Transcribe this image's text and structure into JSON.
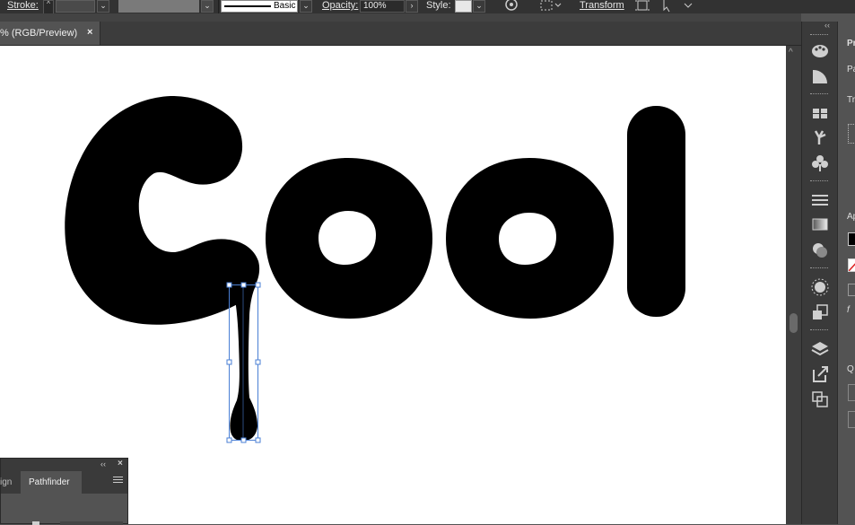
{
  "control_bar": {
    "stroke_label": "Stroke:",
    "stroke_profile": "Basic",
    "opacity_label": "Opacity:",
    "opacity_value": "100%",
    "style_label": "Style:",
    "transform_label": "Transform",
    "spinner_up": "^",
    "spinner_down": "v",
    "chevron": "⌄",
    "arrow_right": "›"
  },
  "document_tab": {
    "title": "% (RGB/Preview)",
    "close": "×"
  },
  "artwork": {
    "text": "Cool",
    "fill": "#000000",
    "selection_color": "#4a7fd4"
  },
  "dock": {
    "collapse": "‹‹",
    "icons": [
      "color-palette-icon",
      "color-guide-icon",
      "swatches-icon",
      "brushes-icon",
      "symbols-icon",
      "stroke-icon",
      "gradient-icon",
      "transparency-icon",
      "appearance-icon",
      "graphic-styles-icon",
      "layers-icon",
      "asset-export-icon",
      "artboards-icon"
    ]
  },
  "properties_strip": {
    "title_fragment": "Pr",
    "pa_fragment": "Pa",
    "tr_fragment": "Tr",
    "ap_fragment": "Ap",
    "q_fragment": "Q",
    "f_fragment": "f"
  },
  "pathfinder_panel": {
    "collapse": "‹‹",
    "close": "×",
    "tab_align": "ign",
    "tab_pathfinder": "Pathfinder"
  },
  "scrollbar": {
    "up_arrow": "^"
  }
}
